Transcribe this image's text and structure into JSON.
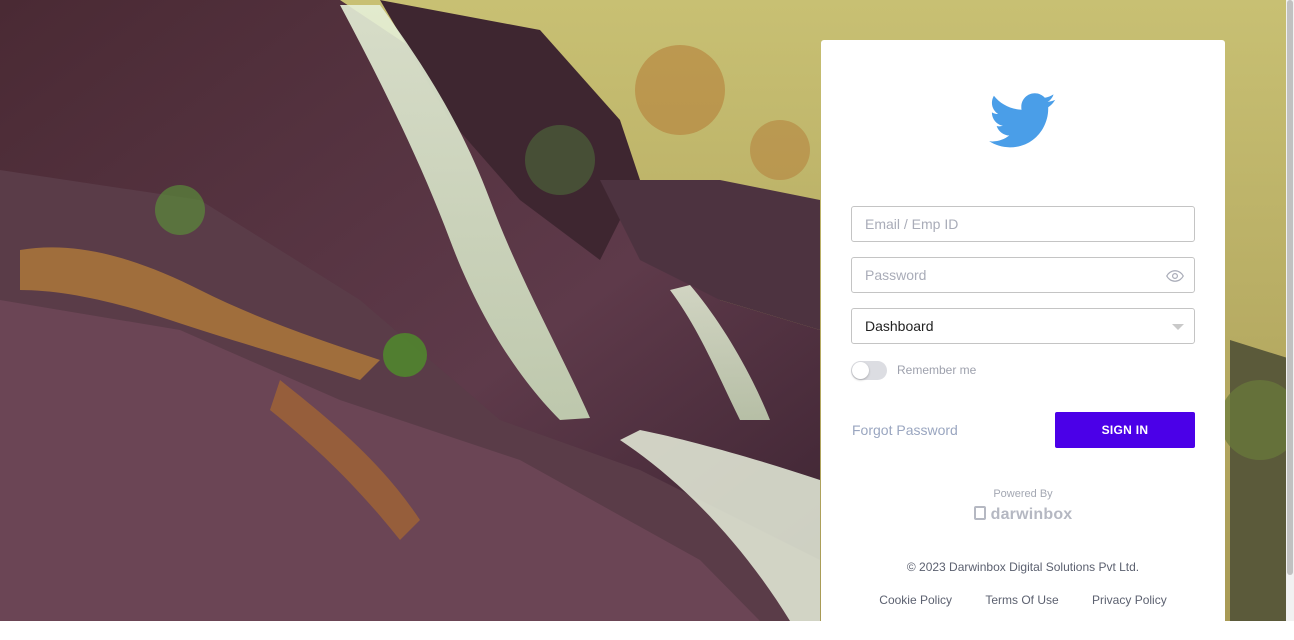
{
  "login": {
    "email_placeholder": "Email / Emp ID",
    "password_placeholder": "Password",
    "dropdown_selected": "Dashboard",
    "remember_label": "Remember me",
    "remember_checked": false,
    "forgot_label": "Forgot Password",
    "signin_label": "SIGN IN"
  },
  "footer": {
    "powered_by": "Powered By",
    "brand": "darwinbox",
    "copyright": "© 2023 Darwinbox Digital Solutions Pvt Ltd.",
    "links": [
      "Cookie Policy",
      "Terms Of Use",
      "Privacy Policy"
    ]
  },
  "icons": {
    "logo": "twitter-bird-icon",
    "password_toggle": "eye-icon",
    "dropdown": "chevron-down-icon"
  },
  "colors": {
    "primary": "#4b00e8",
    "logo_blue": "#4a9ee8"
  }
}
